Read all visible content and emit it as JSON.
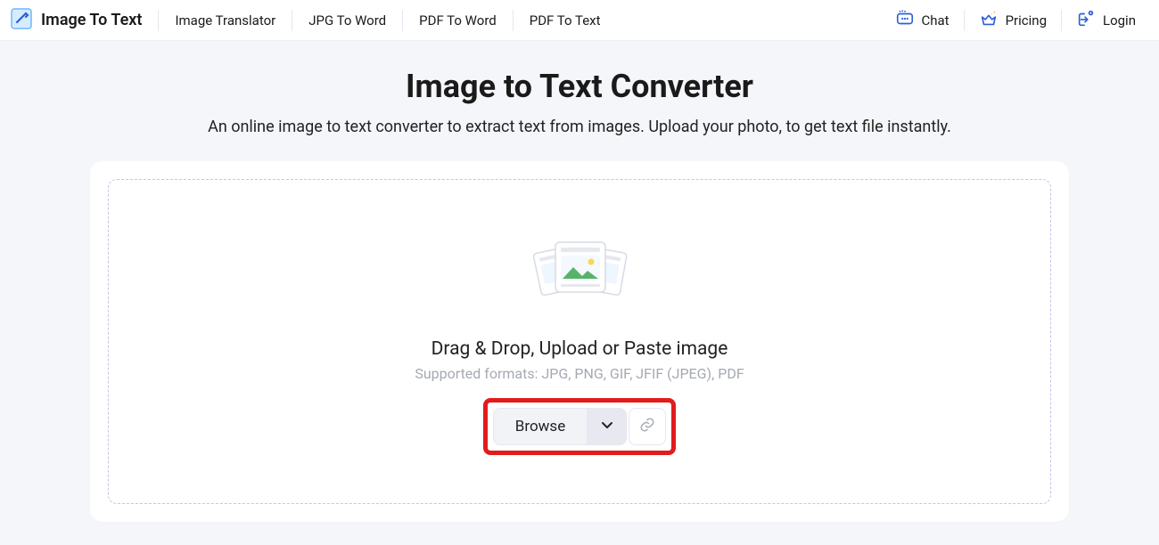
{
  "header": {
    "logo_text": "Image To Text",
    "nav": [
      "Image Translator",
      "JPG To Word",
      "PDF To Word",
      "PDF To Text"
    ],
    "right": {
      "chat": "Chat",
      "pricing": "Pricing",
      "login": "Login"
    }
  },
  "main": {
    "title": "Image to Text Converter",
    "subtitle": "An online image to text converter to extract text from images. Upload your photo, to get text file instantly.",
    "dropzone": {
      "drop_text": "Drag & Drop, Upload or Paste image",
      "formats": "Supported formats: JPG, PNG, GIF, JFIF (JPEG), PDF",
      "browse_label": "Browse"
    }
  }
}
